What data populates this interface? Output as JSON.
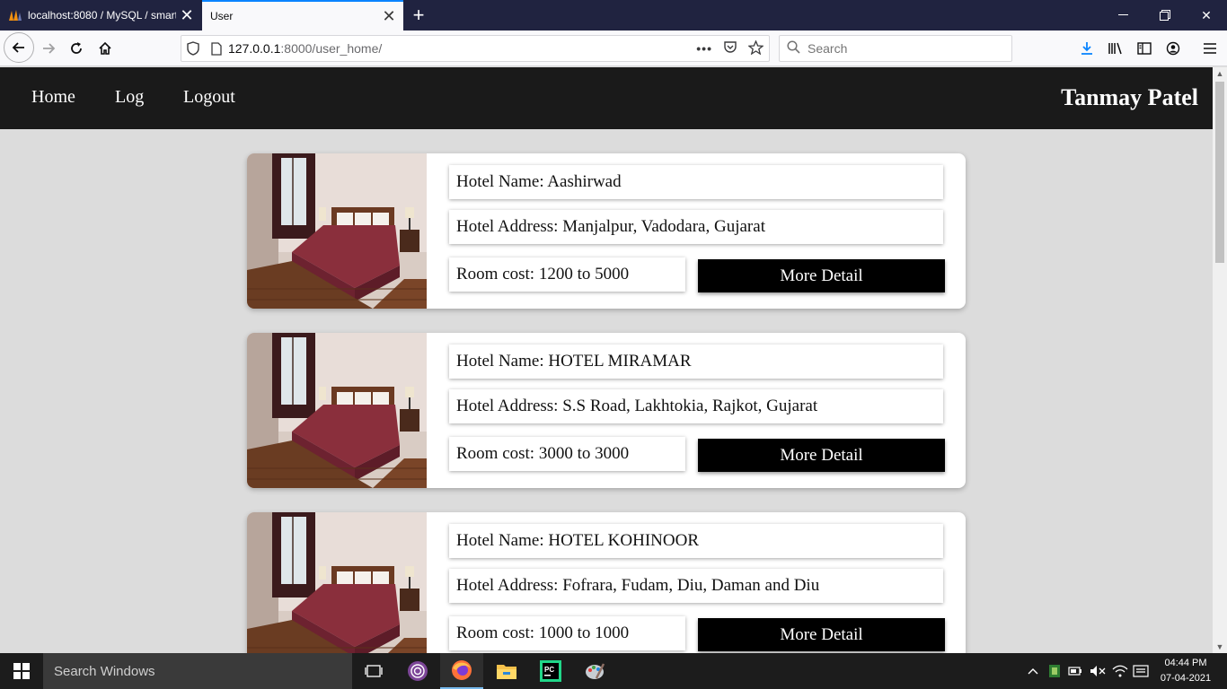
{
  "browser": {
    "tabs": [
      {
        "title": "localhost:8080 / MySQL / smart",
        "active": false
      },
      {
        "title": "User",
        "active": true
      }
    ],
    "url_host": "127.0.0.1",
    "url_rest": ":8000/user_home/",
    "search_placeholder": "Search"
  },
  "site": {
    "nav": [
      {
        "label": "Home"
      },
      {
        "label": "Log"
      },
      {
        "label": "Logout"
      }
    ],
    "user_name": "Tanmay Patel"
  },
  "hotels": [
    {
      "name": "Hotel Name: Aashirwad",
      "address": "Hotel Address: Manjalpur, Vadodara, Gujarat",
      "cost": "Room cost: 1200 to 5000",
      "button": "More Detail"
    },
    {
      "name": "Hotel Name: HOTEL MIRAMAR",
      "address": "Hotel Address: S.S Road, Lakhtokia, Rajkot, Gujarat",
      "cost": "Room cost: 3000 to 3000",
      "button": "More Detail"
    },
    {
      "name": "Hotel Name: HOTEL KOHINOOR",
      "address": "Hotel Address: Fofrara, Fudam, Diu, Daman and Diu",
      "cost": "Room cost: 1000 to 1000",
      "button": "More Detail"
    }
  ],
  "taskbar": {
    "search_text": "Search Windows",
    "time": "04:44 PM",
    "date": "07-04-2021"
  },
  "colors": {
    "nav_bg": "#1a1a1a",
    "page_bg": "#dcdcdc",
    "button_bg": "#000000",
    "tab_strip": "#202340"
  }
}
